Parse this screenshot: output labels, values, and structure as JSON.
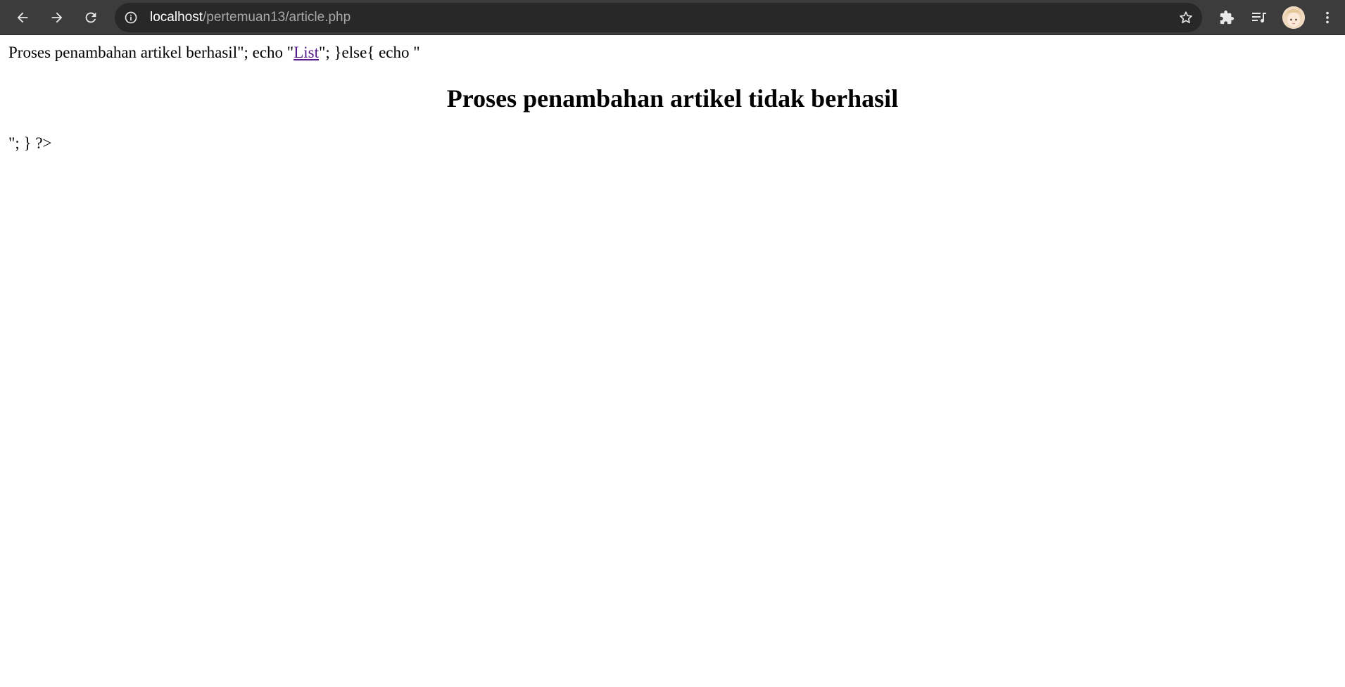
{
  "browser": {
    "url_host": "localhost",
    "url_path": "/pertemuan13/article.php",
    "icons": {
      "back": "arrow-left-icon",
      "forward": "arrow-right-icon",
      "reload": "reload-icon",
      "site_info": "info-icon",
      "bookmark": "star-icon",
      "extensions": "puzzle-icon",
      "media": "media-queue-icon",
      "menu": "kebab-menu-icon"
    },
    "colors": {
      "toolbar": "#3c3c3c",
      "omnibox": "#282828"
    }
  },
  "page": {
    "line1_before": "Proses penambahan artikel berhasil\"; echo \"",
    "line1_link": "List",
    "line1_after": "\"; }else{ echo \"",
    "heading": "Proses penambahan artikel tidak berhasil",
    "line3": "\"; } ?>",
    "colors": {
      "visited_link": "#551a8b"
    }
  }
}
